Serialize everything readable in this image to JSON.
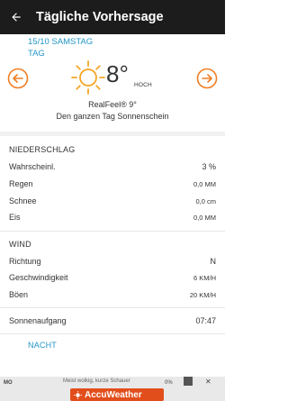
{
  "app_bar": {
    "title": "Tägliche Vorhersage"
  },
  "day_header": {
    "line1": "15/10 SAMSTAG",
    "line2": "TAG"
  },
  "current": {
    "temperature": "8°",
    "temp_label": "HOCH",
    "realfeel": "RealFeel® 9°",
    "description": "Den ganzen Tag Sonnenschein",
    "icon": "sun-icon"
  },
  "precipitation": {
    "title": "NIEDERSCHLAG",
    "rows": [
      {
        "label": "Wahrscheinl.",
        "value": "3 %"
      },
      {
        "label": "Regen",
        "value": "0,0 MM"
      },
      {
        "label": "Schnee",
        "value": "0,0 cm"
      },
      {
        "label": "Eis",
        "value": "0,0 MM"
      }
    ]
  },
  "wind": {
    "title": "WIND",
    "rows": [
      {
        "label": "Richtung",
        "value": "N"
      },
      {
        "label": "Geschwindigkeit",
        "value": "6 KM/H"
      },
      {
        "label": "Böen",
        "value": "20 KM/H"
      }
    ]
  },
  "sunrise": {
    "label": "Sonnenaufgang",
    "value": "07:47"
  },
  "night_button": "NACHT",
  "ad": {
    "prefix": "MO",
    "text": "Meist wolkig, kurze Schauer",
    "brand": "AccuWeather",
    "right_text": "0%"
  },
  "colors": {
    "accent": "#2196c6",
    "nav_orange": "#f07d22",
    "sun": "#f5a623",
    "app_bar": "#1c1c1c"
  }
}
